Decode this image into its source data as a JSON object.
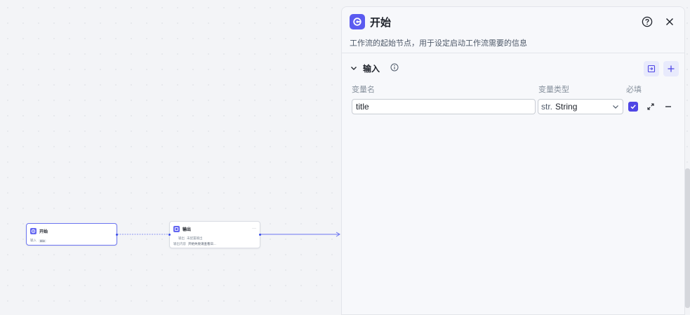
{
  "canvas": {
    "start_node": {
      "title": "开始",
      "row_label": "输入",
      "chip": "title"
    },
    "output_node": {
      "title": "输出",
      "more": "···",
      "row1_label": "输出",
      "row1_value": "未配置输出",
      "row2_label": "输出内容",
      "row2_value": "开始失败请查看日..."
    }
  },
  "panel": {
    "title": "开始",
    "description": "工作流的起始节点，用于设定启动工作流需要的信息",
    "help_icon": "question-circle-icon",
    "close_icon": "close-icon",
    "section": {
      "title": "输入",
      "info_icon": "info-circle-icon",
      "import_icon": "import-icon",
      "add_icon": "plus-icon"
    },
    "columns": {
      "name": "变量名",
      "type": "变量类型",
      "required": "必填"
    },
    "rows": [
      {
        "name": "title",
        "type_prefix": "str.",
        "type": "String",
        "required": true
      }
    ]
  },
  "colors": {
    "accent": "#5b5bf0",
    "edge": "#6b74f0"
  }
}
